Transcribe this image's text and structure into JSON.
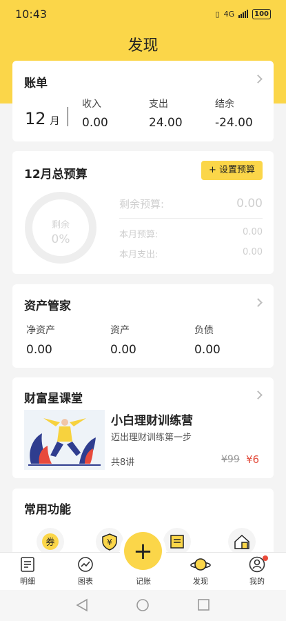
{
  "status_bar": {
    "time": "10:43",
    "network": "4G",
    "battery": "100"
  },
  "page": {
    "title": "发现"
  },
  "bill": {
    "title": "账单",
    "month_number": "12",
    "month_unit": "月",
    "income_label": "收入",
    "income_value": "0.00",
    "expense_label": "支出",
    "expense_value": "24.00",
    "balance_label": "结余",
    "balance_value": "-24.00"
  },
  "budget": {
    "title": "12月总预算",
    "set_button": "设置预算",
    "ring_label": "剩余",
    "ring_percent": "0%",
    "remaining_label": "剩余预算:",
    "remaining_value": "0.00",
    "month_budget_label": "本月预算:",
    "month_budget_value": "0.00",
    "month_expense_label": "本月支出:",
    "month_expense_value": "0.00"
  },
  "assets": {
    "title": "资产管家",
    "net_label": "净资产",
    "net_value": "0.00",
    "asset_label": "资产",
    "asset_value": "0.00",
    "debt_label": "负债",
    "debt_value": "0.00"
  },
  "course": {
    "section_title": "财富星课堂",
    "title": "小白理财训练营",
    "subtitle": "迈出理财训练第一步",
    "lessons": "共8讲",
    "old_price": "¥99",
    "new_price": "¥6"
  },
  "common": {
    "title": "常用功能",
    "icons": [
      "coupon-icon",
      "shield-yen-icon",
      "receipt-icon",
      "house-icon"
    ]
  },
  "tabbar": {
    "details": "明细",
    "charts": "图表",
    "record": "记账",
    "discover": "发现",
    "mine": "我的",
    "fab_symbol": "+"
  },
  "colors": {
    "accent": "#fbd649",
    "price_red": "#e24b3b",
    "notify_dot": "#ea4a3a"
  }
}
